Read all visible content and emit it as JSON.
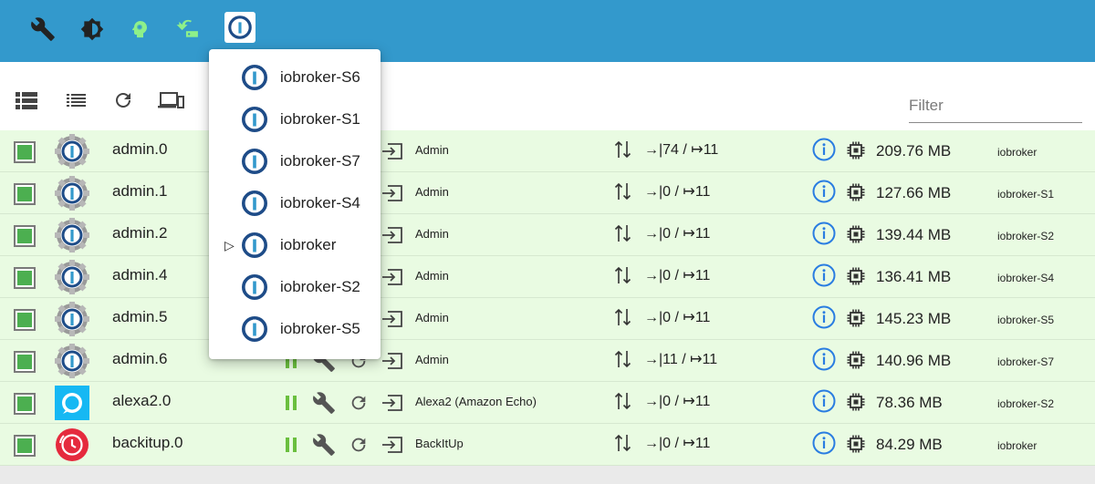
{
  "topbar": {
    "color": "#3399cc",
    "icons": [
      "wrench-icon",
      "brightness-icon",
      "head-icon",
      "restart-icon",
      "iobroker-logo-icon"
    ]
  },
  "toolbar": {
    "icons": [
      "view-tile-icon",
      "view-list-icon",
      "refresh-icon",
      "devices-icon"
    ],
    "filter_placeholder": "Filter",
    "filter_value": ""
  },
  "host_menu": {
    "items": [
      {
        "label": "iobroker-S6",
        "selected": false
      },
      {
        "label": "iobroker-S1",
        "selected": false
      },
      {
        "label": "iobroker-S7",
        "selected": false
      },
      {
        "label": "iobroker-S4",
        "selected": false
      },
      {
        "label": "iobroker",
        "selected": true
      },
      {
        "label": "iobroker-S2",
        "selected": false
      },
      {
        "label": "iobroker-S5",
        "selected": false
      }
    ]
  },
  "instances": [
    {
      "name": "admin.0",
      "icon": "admin",
      "title": "Admin",
      "events_in": "74",
      "events_out": "11",
      "memory": "209.76 MB",
      "host": "iobroker",
      "controls": false
    },
    {
      "name": "admin.1",
      "icon": "admin",
      "title": "Admin",
      "events_in": "0",
      "events_out": "11",
      "memory": "127.66 MB",
      "host": "iobroker-S1",
      "controls": false
    },
    {
      "name": "admin.2",
      "icon": "admin",
      "title": "Admin",
      "events_in": "0",
      "events_out": "11",
      "memory": "139.44 MB",
      "host": "iobroker-S2",
      "controls": false
    },
    {
      "name": "admin.4",
      "icon": "admin",
      "title": "Admin",
      "events_in": "0",
      "events_out": "11",
      "memory": "136.41 MB",
      "host": "iobroker-S4",
      "controls": false
    },
    {
      "name": "admin.5",
      "icon": "admin",
      "title": "Admin",
      "events_in": "0",
      "events_out": "11",
      "memory": "145.23 MB",
      "host": "iobroker-S5",
      "controls": false
    },
    {
      "name": "admin.6",
      "icon": "admin",
      "title": "Admin",
      "events_in": "11",
      "events_out": "11",
      "memory": "140.96 MB",
      "host": "iobroker-S7",
      "controls": "partial"
    },
    {
      "name": "alexa2.0",
      "icon": "alexa",
      "title": "Alexa2 (Amazon Echo)",
      "events_in": "0",
      "events_out": "11",
      "memory": "78.36 MB",
      "host": "iobroker-S2",
      "controls": true
    },
    {
      "name": "backitup.0",
      "icon": "backitup",
      "title": "BackItUp",
      "events_in": "0",
      "events_out": "11",
      "memory": "84.29 MB",
      "host": "iobroker",
      "controls": true
    }
  ],
  "colors": {
    "row_bg": "#e9fbe2",
    "enabled": "#4caf50",
    "info": "#2a7de1",
    "logo_blue": "#1e4c88",
    "pause_green": "#6abf3e"
  }
}
